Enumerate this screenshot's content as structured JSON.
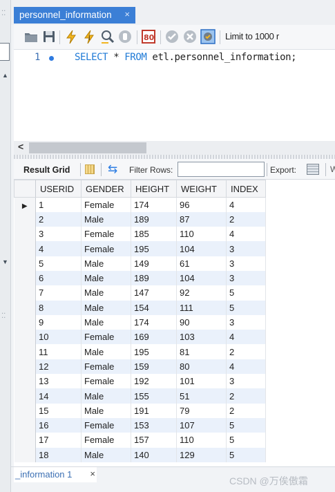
{
  "document_tab": {
    "title": "personnel_information",
    "close": "×"
  },
  "toolbar": {
    "limit_label": "Limit to 1000 r"
  },
  "editor": {
    "line_number": "1",
    "sql": {
      "kw1": "SELECT",
      "rest1": " * ",
      "kw2": "FROM",
      "rest2": " etl.personnel_information;"
    }
  },
  "result_toolbar": {
    "result_grid": "Result Grid",
    "filter_label": "Filter Rows:",
    "filter_value": "",
    "export_label": "Export:",
    "wrap_cut": "W"
  },
  "table": {
    "columns": [
      "USERID",
      "GENDER",
      "HEIGHT",
      "WEIGHT",
      "INDEX"
    ],
    "rows": [
      [
        "1",
        "Female",
        "174",
        "96",
        "4"
      ],
      [
        "2",
        "Male",
        "189",
        "87",
        "2"
      ],
      [
        "3",
        "Female",
        "185",
        "110",
        "4"
      ],
      [
        "4",
        "Female",
        "195",
        "104",
        "3"
      ],
      [
        "5",
        "Male",
        "149",
        "61",
        "3"
      ],
      [
        "6",
        "Male",
        "189",
        "104",
        "3"
      ],
      [
        "7",
        "Male",
        "147",
        "92",
        "5"
      ],
      [
        "8",
        "Male",
        "154",
        "111",
        "5"
      ],
      [
        "9",
        "Male",
        "174",
        "90",
        "3"
      ],
      [
        "10",
        "Female",
        "169",
        "103",
        "4"
      ],
      [
        "11",
        "Male",
        "195",
        "81",
        "2"
      ],
      [
        "12",
        "Female",
        "159",
        "80",
        "4"
      ],
      [
        "13",
        "Female",
        "192",
        "101",
        "3"
      ],
      [
        "14",
        "Male",
        "155",
        "51",
        "2"
      ],
      [
        "15",
        "Male",
        "191",
        "79",
        "2"
      ],
      [
        "16",
        "Female",
        "153",
        "107",
        "5"
      ],
      [
        "17",
        "Female",
        "157",
        "110",
        "5"
      ],
      [
        "18",
        "Male",
        "140",
        "129",
        "5"
      ]
    ],
    "current_row_indicator": "▶"
  },
  "bottom_tab": {
    "title": "_information 1",
    "close": "×"
  },
  "watermark": "CSDN @万俟傲霜",
  "colors": {
    "accent": "#3b7fd6",
    "keyword": "#1f7ad6",
    "alt_row": "#eaf1fb"
  }
}
